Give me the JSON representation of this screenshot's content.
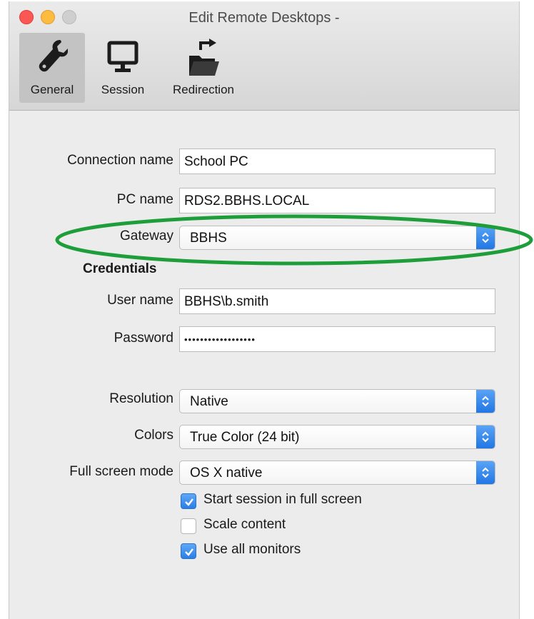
{
  "window": {
    "title": "Edit Remote Desktops -"
  },
  "toolbar": {
    "items": [
      {
        "label": "General",
        "icon": "wrench-icon",
        "active": true
      },
      {
        "label": "Session",
        "icon": "monitor-icon",
        "active": false
      },
      {
        "label": "Redirection",
        "icon": "folder-redirect-icon",
        "active": false
      }
    ]
  },
  "form": {
    "connection_name_label": "Connection name",
    "connection_name_value": "School PC",
    "pc_name_label": "PC name",
    "pc_name_value": "RDS2.BBHS.LOCAL",
    "gateway_label": "Gateway",
    "gateway_value": "BBHS",
    "credentials_heading": "Credentials",
    "user_name_label": "User name",
    "user_name_value": "BBHS\\b.smith",
    "password_label": "Password",
    "password_value": "••••••••••••••••••",
    "resolution_label": "Resolution",
    "resolution_value": "Native",
    "colors_label": "Colors",
    "colors_value": "True Color (24 bit)",
    "full_screen_label": "Full screen mode",
    "full_screen_value": "OS X native",
    "checkboxes": [
      {
        "label": "Start session in full screen",
        "checked": true
      },
      {
        "label": "Scale content",
        "checked": false
      },
      {
        "label": "Use all monitors",
        "checked": true
      }
    ]
  },
  "annotation": {
    "highlight_color": "#1e9e3a"
  }
}
